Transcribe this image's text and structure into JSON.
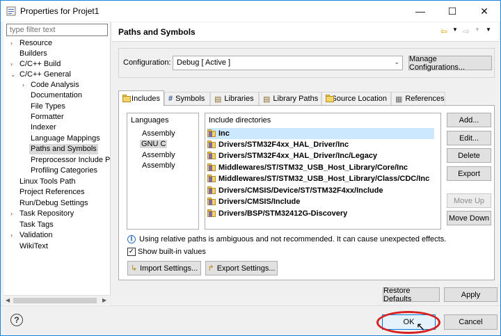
{
  "window": {
    "title": "Properties for Projet1",
    "minimize_icon": "minimize-icon",
    "maximize_icon": "maximize-icon",
    "close_icon": "close-icon"
  },
  "filter": {
    "placeholder": "type filter text"
  },
  "tree": {
    "items": [
      {
        "label": "Resource",
        "twisty": "›"
      },
      {
        "label": "Builders",
        "twisty": ""
      },
      {
        "label": "C/C++ Build",
        "twisty": "›"
      },
      {
        "label": "C/C++ General",
        "twisty": "⌄"
      },
      {
        "label": "Code Analysis",
        "twisty": "›"
      },
      {
        "label": "Documentation",
        "twisty": ""
      },
      {
        "label": "File Types",
        "twisty": ""
      },
      {
        "label": "Formatter",
        "twisty": ""
      },
      {
        "label": "Indexer",
        "twisty": ""
      },
      {
        "label": "Language Mappings",
        "twisty": ""
      },
      {
        "label": "Paths and Symbols",
        "twisty": ""
      },
      {
        "label": "Preprocessor Include Pa",
        "twisty": ""
      },
      {
        "label": "Profiling Categories",
        "twisty": ""
      },
      {
        "label": "Linux Tools Path",
        "twisty": ""
      },
      {
        "label": "Project References",
        "twisty": ""
      },
      {
        "label": "Run/Debug Settings",
        "twisty": ""
      },
      {
        "label": "Task Repository",
        "twisty": "›"
      },
      {
        "label": "Task Tags",
        "twisty": ""
      },
      {
        "label": "Validation",
        "twisty": "›"
      },
      {
        "label": "WikiText",
        "twisty": ""
      }
    ]
  },
  "page": {
    "title": "Paths and Symbols"
  },
  "configuration": {
    "label": "Configuration:",
    "value": "Debug  [ Active ]",
    "manage_button": "Manage Configurations..."
  },
  "tabs": [
    {
      "label": "Includes",
      "icon": "includes-icon"
    },
    {
      "label": "Symbols",
      "icon": "hash-icon"
    },
    {
      "label": "Libraries",
      "icon": "libraries-icon"
    },
    {
      "label": "Library Paths",
      "icon": "library-paths-icon"
    },
    {
      "label": "Source Location",
      "icon": "folder-icon"
    },
    {
      "label": "References",
      "icon": "references-icon"
    }
  ],
  "languages": {
    "header": "Languages",
    "items": [
      "Assembly",
      "GNU C",
      "Assembly",
      "Assembly"
    ]
  },
  "includes": {
    "header": "Include directories",
    "items": [
      "Inc",
      "Drivers/STM32F4xx_HAL_Driver/Inc",
      "Drivers/STM32F4xx_HAL_Driver/Inc/Legacy",
      "Middlewares/ST/STM32_USB_Host_Library/Core/Inc",
      "Middlewares/ST/STM32_USB_Host_Library/Class/CDC/Inc",
      "Drivers/CMSIS/Device/ST/STM32F4xx/Include",
      "Drivers/CMSIS/Include",
      "Drivers/BSP/STM32412G-Discovery"
    ]
  },
  "side_buttons": {
    "add": "Add...",
    "edit": "Edit...",
    "delete": "Delete",
    "export": "Export",
    "move_up": "Move Up",
    "move_down": "Move Down"
  },
  "info": {
    "text": "Using relative paths is ambiguous and not recommended. It can cause unexpected effects."
  },
  "show_builtin": {
    "label": "Show built-in values",
    "checked": true
  },
  "import_export": {
    "import": "Import Settings...",
    "export": "Export Settings..."
  },
  "page_buttons": {
    "restore": "Restore Defaults",
    "apply": "Apply"
  },
  "dialog_buttons": {
    "ok": "OK",
    "cancel": "Cancel"
  },
  "help": {
    "symbol": "?"
  }
}
